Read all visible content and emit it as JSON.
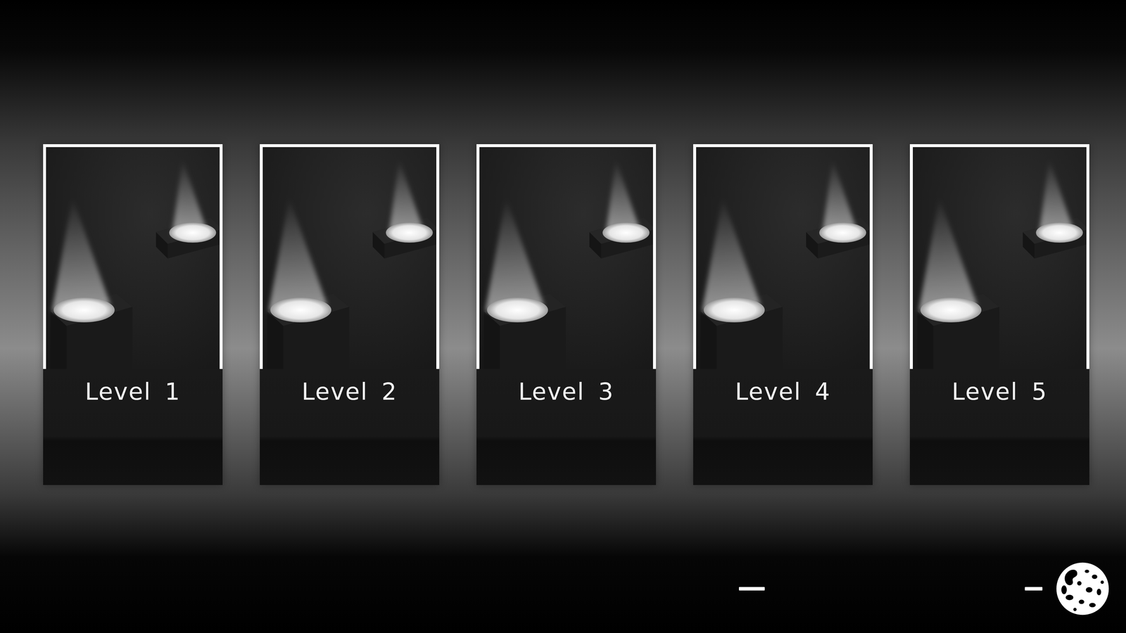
{
  "screen": "level-select",
  "levels": [
    {
      "label": "Level 1"
    },
    {
      "label": "Level 2"
    },
    {
      "label": "Level 3"
    },
    {
      "label": "Level 4"
    },
    {
      "label": "Level 5"
    }
  ]
}
